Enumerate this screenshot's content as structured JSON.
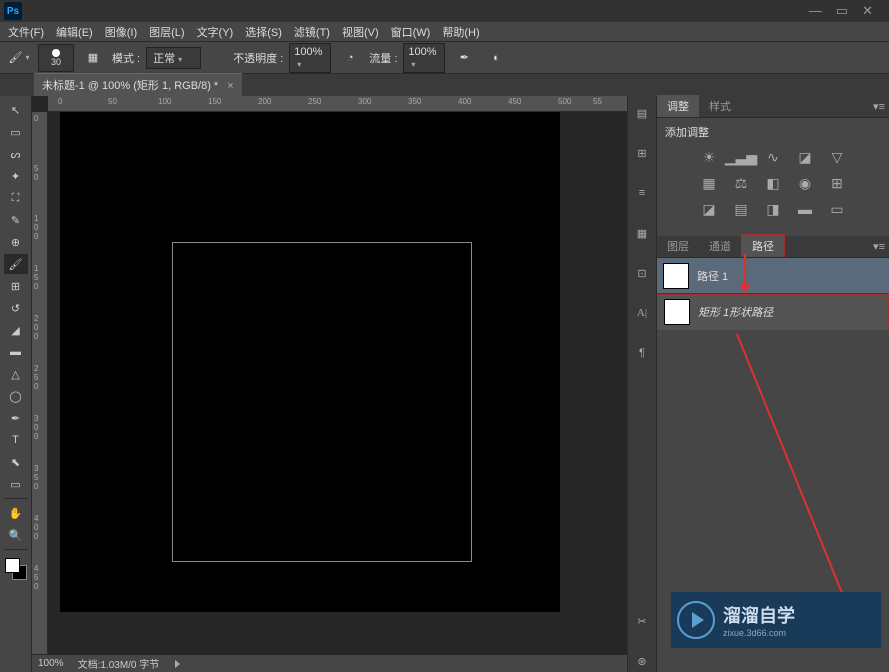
{
  "app": {
    "logo": "Ps"
  },
  "menu": {
    "file": "文件(F)",
    "edit": "编辑(E)",
    "image": "图像(I)",
    "layer": "图层(L)",
    "type": "文字(Y)",
    "select": "选择(S)",
    "filter": "滤镜(T)",
    "view": "视图(V)",
    "window": "窗口(W)",
    "help": "帮助(H)"
  },
  "options": {
    "brush_size": "30",
    "mode_label": "模式 :",
    "mode_value": "正常",
    "opacity_label": "不透明度 :",
    "opacity_value": "100%",
    "flow_label": "流量 :",
    "flow_value": "100%"
  },
  "document": {
    "tab_title": "未标题-1 @ 100% (矩形 1, RGB/8) *"
  },
  "status": {
    "zoom": "100%",
    "docinfo": "文档:1.03M/0 字节"
  },
  "panels": {
    "adjust_tab": "调整",
    "styles_tab": "样式",
    "adjust_title": "添加调整",
    "layers_tab": "图层",
    "channels_tab": "通道",
    "paths_tab": "路径",
    "paths": [
      {
        "name": "路径 1"
      },
      {
        "name": "矩形 1形状路径"
      }
    ]
  },
  "watermark": {
    "name": "溜溜自学",
    "url": "zixue.3d66.com"
  }
}
